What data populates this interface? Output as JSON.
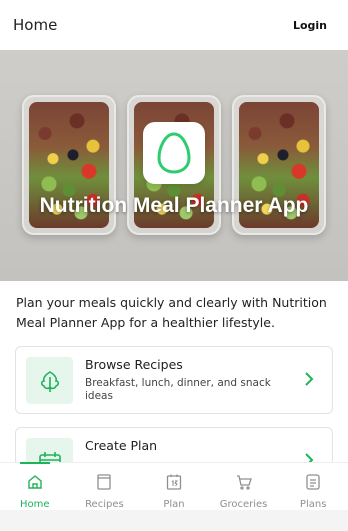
{
  "header": {
    "title": "Home",
    "login_label": "Login"
  },
  "hero": {
    "title": "Nutrition Meal Planner App",
    "icon": "egg-logo-icon"
  },
  "intro_text": "Plan your meals quickly and clearly with Nutrition Meal Planner App for a healthier lifestyle.",
  "cards": [
    {
      "title": "Browse Recipes",
      "subtitle": "Breakfast, lunch, dinner, and snack ideas",
      "icon": "leaf-icon"
    },
    {
      "title": "Create Plan",
      "subtitle": "",
      "icon": "calendar-icon"
    }
  ],
  "nav": [
    {
      "label": "Home",
      "icon": "home-icon",
      "active": true
    },
    {
      "label": "Recipes",
      "icon": "book-icon",
      "active": false
    },
    {
      "label": "Plan",
      "icon": "calendar-day-icon",
      "active": false
    },
    {
      "label": "Groceries",
      "icon": "cart-icon",
      "active": false
    },
    {
      "label": "Plans",
      "icon": "list-icon",
      "active": false
    }
  ],
  "colors": {
    "accent": "#1fb35a",
    "accent_light": "#e7f6ec",
    "muted": "#8f8f8f"
  }
}
